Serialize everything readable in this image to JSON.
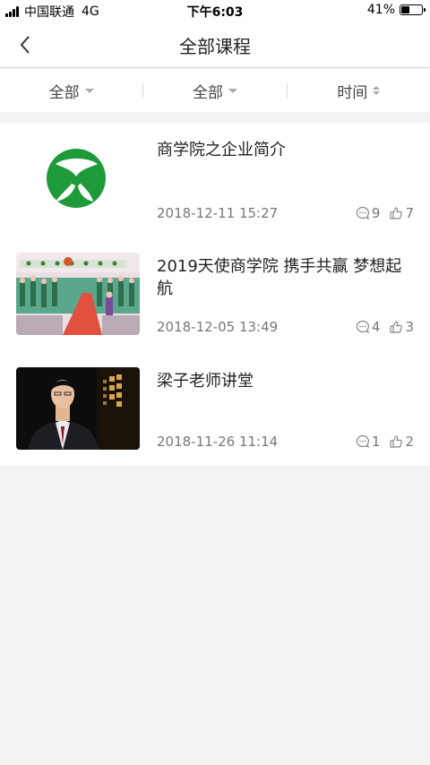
{
  "status_bar": {
    "carrier": "中国联通",
    "network": "4G",
    "time": "下午6:03",
    "battery": "41%",
    "battery_level": 0.41
  },
  "header": {
    "title": "全部课程"
  },
  "filters": [
    {
      "label": "全部"
    },
    {
      "label": "全部"
    },
    {
      "label": "时间"
    }
  ],
  "courses": [
    {
      "title": "商学院之企业简介",
      "date": "2018-12-11 15:27",
      "comments": "9",
      "likes": "7",
      "thumb": "green-logo"
    },
    {
      "title": "2019天使商学院 携手共赢 梦想起航",
      "date": "2018-12-05 13:49",
      "comments": "4",
      "likes": "3",
      "thumb": "event-hall-photo"
    },
    {
      "title": "梁子老师讲堂",
      "date": "2018-11-26 11:14",
      "comments": "1",
      "likes": "2",
      "thumb": "lecturer-photo"
    }
  ],
  "colors": {
    "logo_green": "#1f9a3a",
    "meta_gray": "#777777"
  }
}
